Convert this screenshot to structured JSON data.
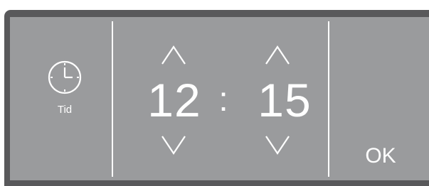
{
  "clock": {
    "icon": "clock-icon",
    "label": "Tid"
  },
  "time": {
    "hours": "12",
    "separator": ":",
    "minutes": "15"
  },
  "controls": {
    "up_icon": "chevron-up-icon",
    "down_icon": "chevron-down-icon",
    "ok_label": "OK"
  },
  "colors": {
    "screen": "#9a9b9d",
    "frame": "#59595b",
    "text": "#ffffff"
  }
}
